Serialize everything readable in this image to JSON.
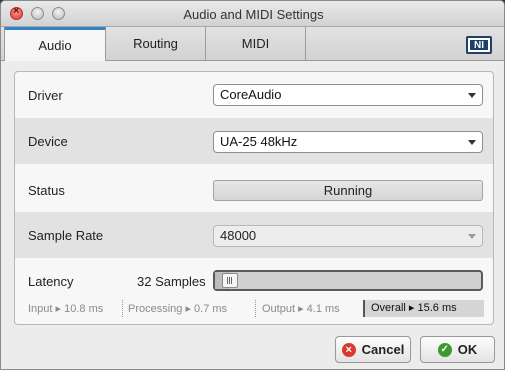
{
  "window": {
    "title": "Audio and MIDI Settings"
  },
  "tabs": [
    {
      "label": "Audio",
      "active": true
    },
    {
      "label": "Routing",
      "active": false
    },
    {
      "label": "MIDI",
      "active": false
    }
  ],
  "logo": {
    "text": "NI"
  },
  "settings": {
    "driver": {
      "label": "Driver",
      "value": "CoreAudio"
    },
    "device": {
      "label": "Device",
      "value": "UA-25 48kHz"
    },
    "status": {
      "label": "Status",
      "value": "Running"
    },
    "sample_rate": {
      "label": "Sample Rate",
      "value": "48000"
    },
    "latency": {
      "label": "Latency",
      "value": "32 Samples",
      "slider_fraction": 0.02
    }
  },
  "timing": {
    "input": "Input ▸ 10.8 ms",
    "processing": "Processing ▸ 0.7 ms",
    "output": "Output ▸ 4.1 ms",
    "overall": "Overall ▸ 15.6 ms"
  },
  "buttons": {
    "cancel": "Cancel",
    "ok": "OK"
  },
  "colors": {
    "accent": "#2e84c9",
    "cancel_icon": "#d83a2f",
    "ok_icon": "#3a9a2c"
  }
}
